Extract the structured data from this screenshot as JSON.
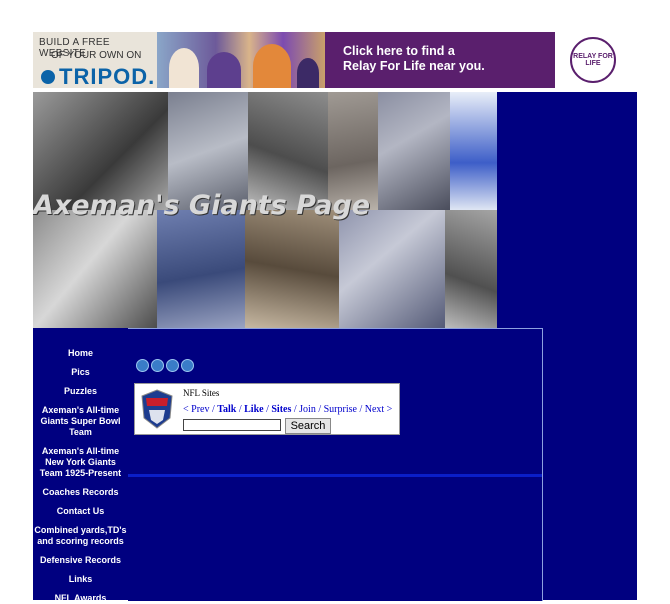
{
  "ad": {
    "tripod_line1": "BUILD A FREE WEBSITE",
    "tripod_line2": "OF YOUR OWN ON",
    "tripod_brand": "TRIPOD.",
    "relay_line1": "Click here to find a",
    "relay_line2": "Relay For Life near you.",
    "relay_badge": "RELAY FOR LIFE"
  },
  "header": {
    "title": "Axeman's Giants Page"
  },
  "nav": {
    "items": [
      {
        "label": "Home"
      },
      {
        "label": "Pics"
      },
      {
        "label": "Puzzles"
      },
      {
        "label": "Axeman's All-time Giants Super Bowl Team"
      },
      {
        "label": "Axeman's All-time New York Giants Team 1925-Present"
      },
      {
        "label": "Coaches Records"
      },
      {
        "label": "Contact Us"
      },
      {
        "label": "Combined yards,TD's and scoring records"
      },
      {
        "label": "Defensive Records"
      },
      {
        "label": "Links"
      },
      {
        "label": "NFL Awards"
      }
    ]
  },
  "webring": {
    "label": "NFL Sites",
    "prev": "< Prev",
    "talk": "Talk",
    "like": "Like",
    "sites": "Sites",
    "join": "Join",
    "surprise": "Surprise",
    "next": "Next >",
    "search_label": "Search",
    "search_value": ""
  },
  "colors": {
    "navy": "#000080",
    "ad_purple": "#5a1f6d",
    "link_blue": "#0000cc"
  }
}
